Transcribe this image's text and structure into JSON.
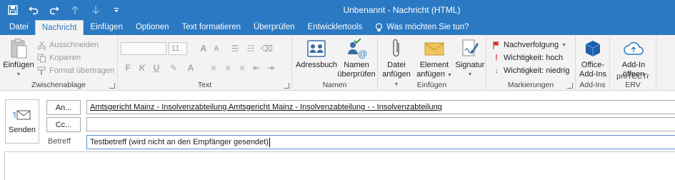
{
  "window": {
    "title": "Unbenannt - Nachricht (HTML)"
  },
  "quick_access": [
    "save-icon",
    "undo-icon",
    "redo-icon",
    "up-arrow-icon",
    "down-arrow-icon",
    "customize-icon"
  ],
  "tabs": [
    "Datei",
    "Nachricht",
    "Einfügen",
    "Optionen",
    "Text formatieren",
    "Überprüfen",
    "Entwicklertools"
  ],
  "active_tab": "Nachricht",
  "tell_me": "Was möchten Sie tun?",
  "ribbon": {
    "clipboard": {
      "label": "Zwischenablage",
      "paste": "Einfügen",
      "cut": "Ausschneiden",
      "copy": "Kopieren",
      "format_painter": "Format übertragen"
    },
    "text": {
      "label": "Text",
      "font_size": "11",
      "grow": "A",
      "shrink": "A",
      "bold": "F",
      "italic": "K",
      "underline": "U"
    },
    "names": {
      "label": "Namen",
      "address_book": "Adressbuch",
      "check_names_1": "Namen",
      "check_names_2": "überprüfen"
    },
    "include": {
      "label": "Einfügen",
      "attach_file_1": "Datei",
      "attach_file_2": "anfügen",
      "attach_item_1": "Element",
      "attach_item_2": "anfügen",
      "signature": "Signatur"
    },
    "tags": {
      "label": "Markierungen",
      "follow_up": "Nachverfolgung",
      "high_importance": "Wichtigkeit: hoch",
      "low_importance": "Wichtigkeit: niedrig"
    },
    "addins": {
      "label": "Add-Ins",
      "office_addins_1": "Office-",
      "office_addins_2": "Add-Ins"
    },
    "protectr": {
      "label": "proTECTr ERV",
      "addin_1": "Add-In",
      "addin_2": "öffnen"
    }
  },
  "compose": {
    "send": "Senden",
    "to_button": "An...",
    "cc_button": "Cc...",
    "subject_label": "Betreff",
    "to_value": "Amtsgericht Mainz - Insolvenzabteilung Amtsgericht Mainz - Insolvenzabteilung - - Insolvenzabteilung",
    "cc_value": "",
    "subject_value": "Testbetreff (wird nicht an den Empfänger gesendet)"
  },
  "colors": {
    "accent": "#2b79c2",
    "ribbon_bg": "#f3f3f3",
    "flag_red": "#d9302b"
  }
}
